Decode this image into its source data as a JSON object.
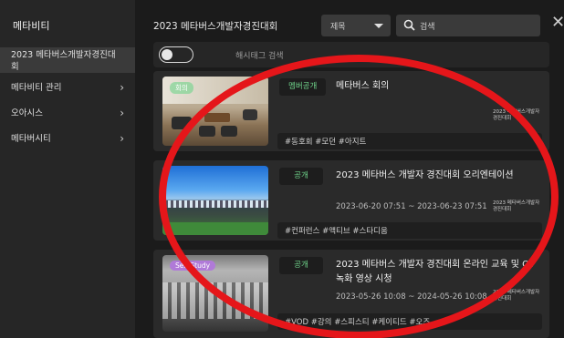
{
  "sidebar": {
    "title": "메타비티",
    "items": [
      {
        "label": "2023 메타버스개발자경진대회",
        "active": true
      },
      {
        "label": "메타비티 관리"
      },
      {
        "label": "오아시스"
      },
      {
        "label": "메타버시티"
      }
    ]
  },
  "header": {
    "title": "2023 메타버스개발자경진대회",
    "filter_value": "제목",
    "search_placeholder": "검색"
  },
  "hashtag_search": {
    "label": "해시태그 검색",
    "enabled": false
  },
  "cards": [
    {
      "badge": "멤버공개",
      "thumb_label": "회의",
      "title": "메타버스 회의",
      "date": "",
      "org": "2023 메타버스개발자경진대회",
      "tags": "#동호회 #모던 #아지트"
    },
    {
      "badge": "공개",
      "thumb_label": "",
      "title": "2023 메타버스 개발자 경진대회 오리엔테이션",
      "date": "2023-06-20 07:51 ~ 2023-06-23 07:51",
      "org": "2023 메타버스개발자경진대회",
      "tags": "#컨퍼런스 #액티브 #스타디움"
    },
    {
      "badge": "공개",
      "thumb_label": "Self-Study",
      "title": "2023 메타버스 개발자 경진대회 온라인 교육 및 OT 녹화 영상 시청",
      "date": "2023-05-26 10:08 ~ 2024-05-26 10:08",
      "org": "2023 메타버스개발자경진대회",
      "tags": "#VOD #강의 #스피스티 #케이티드 #오즈"
    }
  ],
  "colors": {
    "badge_text": "#6fd38a",
    "highlight_ellipse": "#e5161a",
    "background": "#1e1e1e"
  }
}
